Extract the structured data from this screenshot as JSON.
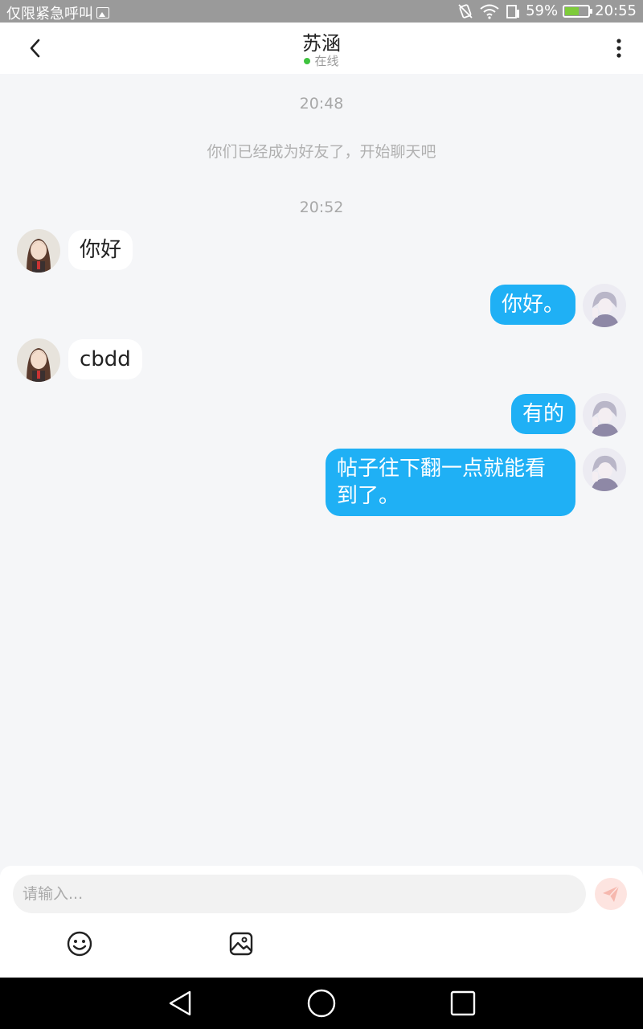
{
  "status_bar": {
    "carrier": "仅限紧急呼叫",
    "battery_percent": "59%",
    "time": "20:55",
    "battery_level": 0.59
  },
  "header": {
    "title": "苏涵",
    "status": "在线"
  },
  "chat": {
    "time_1": "20:48",
    "system_message": "你们已经成为好友了，开始聊天吧",
    "time_2": "20:52",
    "messages": [
      {
        "side": "in",
        "text": "你好"
      },
      {
        "side": "out",
        "text": "你好。"
      },
      {
        "side": "in",
        "text": "cbdd"
      },
      {
        "side": "out",
        "text": "有的"
      },
      {
        "side": "out",
        "text": "帖子往下翻一点就能看到了。"
      }
    ]
  },
  "input": {
    "placeholder": "请输入..."
  },
  "icons": {
    "back": "chevron-left-icon",
    "more": "more-vertical-icon",
    "send": "send-icon",
    "emoji": "emoji-icon",
    "image": "image-icon"
  },
  "colors": {
    "outgoing_bubble": "#1fb0f5",
    "online": "#3fc33f",
    "send_button": "#fde4e0"
  }
}
